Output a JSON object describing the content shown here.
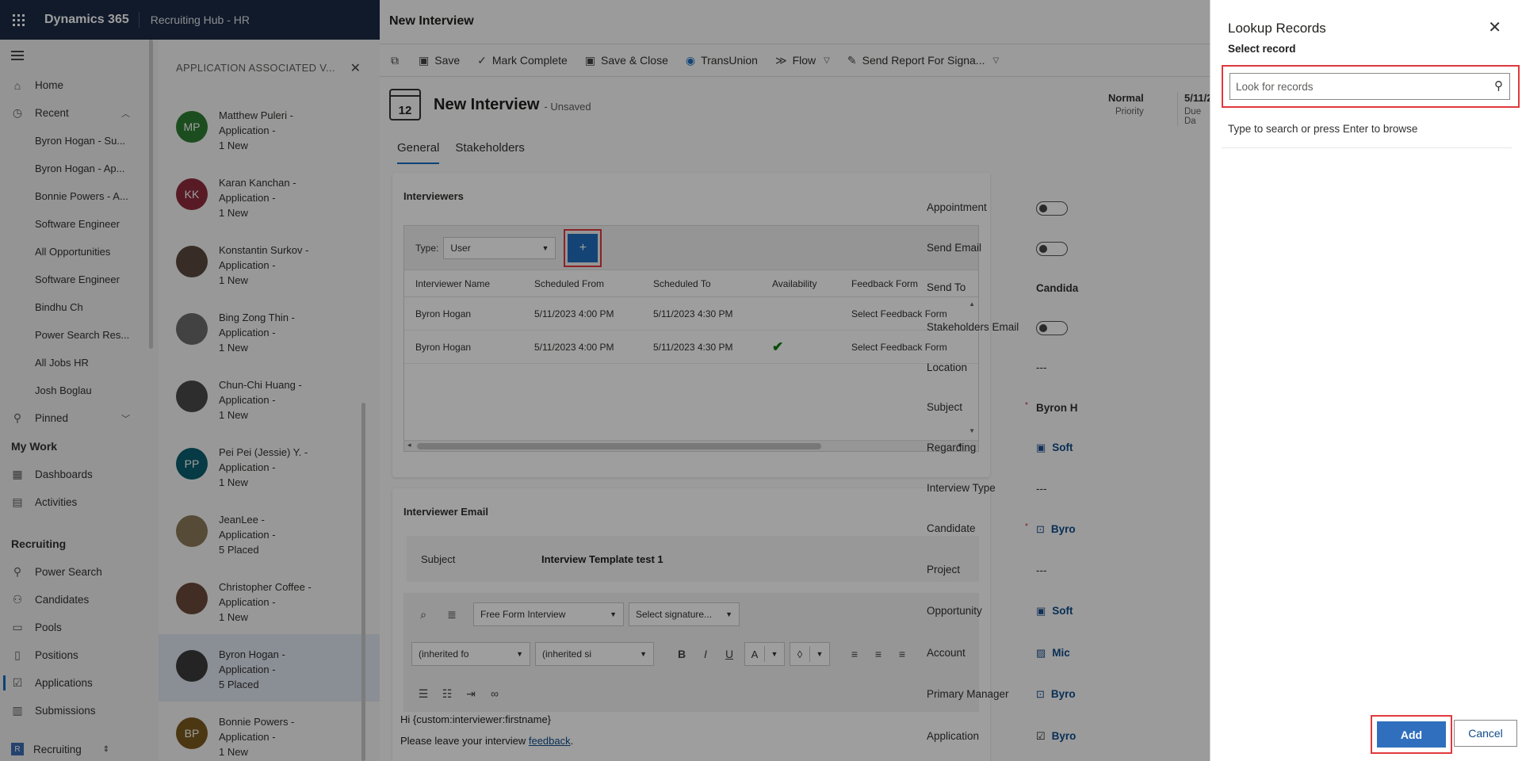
{
  "topbar": {
    "brand": "Dynamics 365",
    "app_name": "Recruiting Hub - HR"
  },
  "nav": {
    "home": "Home",
    "recent": "Recent",
    "recent_items": [
      "Byron Hogan - Su...",
      "Byron Hogan - Ap...",
      "Bonnie Powers - A...",
      "Software Engineer",
      "All Opportunities",
      "Software Engineer",
      "Bindhu Ch",
      "Power Search Res...",
      "All Jobs HR",
      "Josh Boglau"
    ],
    "pinned": "Pinned",
    "my_work_section": "My Work",
    "dashboards": "Dashboards",
    "activities": "Activities",
    "recruiting_section": "Recruiting",
    "power_search": "Power Search",
    "candidates": "Candidates",
    "pools": "Pools",
    "positions": "Positions",
    "applications": "Applications",
    "submissions": "Submissions",
    "area_switcher": "Recruiting",
    "area_badge": "R"
  },
  "assoc": {
    "title": "APPLICATION ASSOCIATED V...",
    "items": [
      {
        "name": "Matthew Puleri -",
        "type": "Application -",
        "status": "1 New",
        "initials": "MP",
        "color": "#2e7d32"
      },
      {
        "name": "Karan Kanchan -",
        "type": "Application -",
        "status": "1 New",
        "initials": "KK",
        "color": "#8e2c3c"
      },
      {
        "name": "Konstantin Surkov -",
        "type": "Application -",
        "status": "1 New",
        "initials": "",
        "color": "#5a4a3e"
      },
      {
        "name": "Bing Zong Thin -",
        "type": "Application -",
        "status": "1 New",
        "initials": "",
        "color": "#6b6b6b"
      },
      {
        "name": "Chun-Chi Huang -",
        "type": "Application -",
        "status": "1 New",
        "initials": "",
        "color": "#4a4a4a"
      },
      {
        "name": "Pei Pei (Jessie) Y. -",
        "type": "Application -",
        "status": "1 New",
        "initials": "PP",
        "color": "#0b5e6e"
      },
      {
        "name": "JeanLee -",
        "type": "Application -",
        "status": "5 Placed",
        "initials": "",
        "color": "#8a7a5a"
      },
      {
        "name": "Christopher Coffee -",
        "type": "Application -",
        "status": "1 New",
        "initials": "",
        "color": "#6a4a3a"
      },
      {
        "name": "Byron Hogan -",
        "type": "Application -",
        "status": "5 Placed",
        "initials": "",
        "color": "#3a3a3a"
      },
      {
        "name": "Bonnie Powers -",
        "type": "Application -",
        "status": "1 New",
        "initials": "BP",
        "color": "#7a5a1e"
      }
    ]
  },
  "form": {
    "window_title": "New Interview",
    "commands": {
      "save": "Save",
      "mark_complete": "Mark Complete",
      "save_close": "Save & Close",
      "transunion": "TransUnion",
      "flow": "Flow",
      "send_report": "Send Report For Signa..."
    },
    "calendar_day": "12",
    "record_title": "New Interview",
    "record_status": "- Unsaved",
    "header_priority_value": "Normal",
    "header_priority_label": "Priority",
    "header_due_value": "5/11/2",
    "header_due_label": "Due Da",
    "tabs": {
      "general": "General",
      "stakeholders": "Stakeholders"
    },
    "interviewers": {
      "title": "Interviewers",
      "type_label": "Type:",
      "type_value": "User",
      "add_symbol": "+",
      "columns": [
        "Interviewer Name",
        "Scheduled From",
        "Scheduled To",
        "Availability",
        "Feedback Form"
      ],
      "rows": [
        {
          "name": "Byron Hogan",
          "from": "5/11/2023 4:00 PM",
          "to": "5/11/2023 4:30 PM",
          "availability": "",
          "feedback": "Select Feedback Form"
        },
        {
          "name": "Byron Hogan",
          "from": "5/11/2023 4:00 PM",
          "to": "5/11/2023 4:30 PM",
          "availability": "✔",
          "feedback": "Select Feedback Form"
        }
      ]
    },
    "email": {
      "title": "Interviewer Email",
      "subject_label": "Subject",
      "subject_value": "Interview Template test 1",
      "template_select": "Free Form Interview",
      "signature_select": "Select signature...",
      "font_select": "(inherited fo",
      "size_select": "(inherited si",
      "body_line1": "Hi {custom:interviewer:firstname}",
      "body_line2_prefix": "Please leave your interview ",
      "body_link": "feedback",
      "body_line2_suffix": "."
    },
    "fields": {
      "appointment": "Appointment",
      "send_email": "Send Email",
      "send_to": "Send To",
      "send_to_value": "Candida",
      "stakeholders_email": "Stakeholders Email",
      "location": "Location",
      "location_value": "---",
      "subject": "Subject",
      "subject_value": "Byron H",
      "regarding": "Regarding",
      "regarding_value": "Soft",
      "interview_type": "Interview Type",
      "interview_type_value": "---",
      "candidate": "Candidate",
      "candidate_value": "Byro",
      "project": "Project",
      "project_value": "---",
      "opportunity": "Opportunity",
      "opportunity_value": "Soft",
      "account": "Account",
      "account_value": "Mic",
      "primary_manager": "Primary Manager",
      "primary_manager_value": "Byro",
      "application": "Application",
      "application_value": "Byro"
    }
  },
  "lookup": {
    "title": "Lookup Records",
    "subtitle": "Select record",
    "search_placeholder": "Look for records",
    "hint": "Type to search or press Enter to browse",
    "add_label": "Add",
    "cancel_label": "Cancel"
  }
}
